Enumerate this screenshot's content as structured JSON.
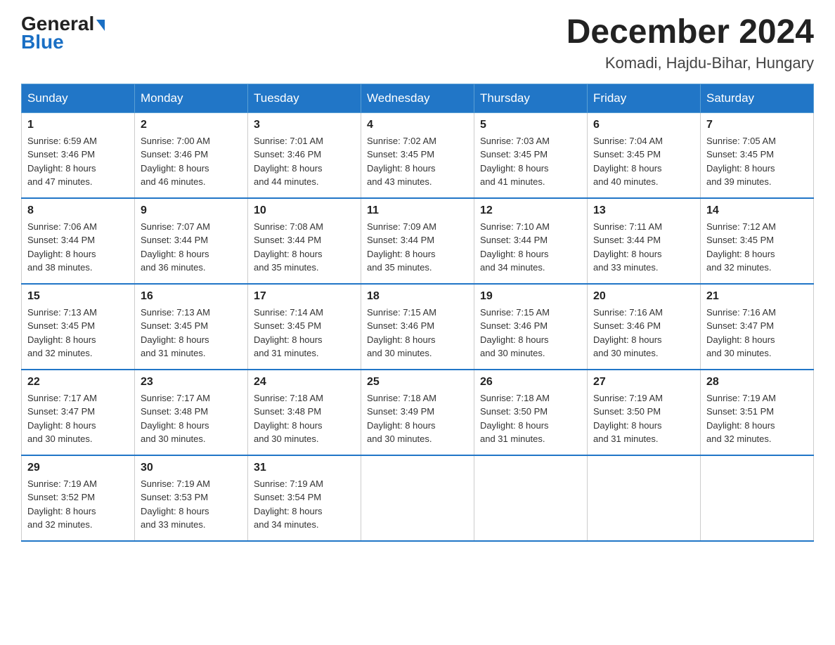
{
  "logo": {
    "line1": "General",
    "line2": "Blue"
  },
  "title": "December 2024",
  "location": "Komadi, Hajdu-Bihar, Hungary",
  "weekdays": [
    "Sunday",
    "Monday",
    "Tuesday",
    "Wednesday",
    "Thursday",
    "Friday",
    "Saturday"
  ],
  "weeks": [
    [
      {
        "day": "1",
        "sunrise": "6:59 AM",
        "sunset": "3:46 PM",
        "daylight": "8 hours and 47 minutes."
      },
      {
        "day": "2",
        "sunrise": "7:00 AM",
        "sunset": "3:46 PM",
        "daylight": "8 hours and 46 minutes."
      },
      {
        "day": "3",
        "sunrise": "7:01 AM",
        "sunset": "3:46 PM",
        "daylight": "8 hours and 44 minutes."
      },
      {
        "day": "4",
        "sunrise": "7:02 AM",
        "sunset": "3:45 PM",
        "daylight": "8 hours and 43 minutes."
      },
      {
        "day": "5",
        "sunrise": "7:03 AM",
        "sunset": "3:45 PM",
        "daylight": "8 hours and 41 minutes."
      },
      {
        "day": "6",
        "sunrise": "7:04 AM",
        "sunset": "3:45 PM",
        "daylight": "8 hours and 40 minutes."
      },
      {
        "day": "7",
        "sunrise": "7:05 AM",
        "sunset": "3:45 PM",
        "daylight": "8 hours and 39 minutes."
      }
    ],
    [
      {
        "day": "8",
        "sunrise": "7:06 AM",
        "sunset": "3:44 PM",
        "daylight": "8 hours and 38 minutes."
      },
      {
        "day": "9",
        "sunrise": "7:07 AM",
        "sunset": "3:44 PM",
        "daylight": "8 hours and 36 minutes."
      },
      {
        "day": "10",
        "sunrise": "7:08 AM",
        "sunset": "3:44 PM",
        "daylight": "8 hours and 35 minutes."
      },
      {
        "day": "11",
        "sunrise": "7:09 AM",
        "sunset": "3:44 PM",
        "daylight": "8 hours and 35 minutes."
      },
      {
        "day": "12",
        "sunrise": "7:10 AM",
        "sunset": "3:44 PM",
        "daylight": "8 hours and 34 minutes."
      },
      {
        "day": "13",
        "sunrise": "7:11 AM",
        "sunset": "3:44 PM",
        "daylight": "8 hours and 33 minutes."
      },
      {
        "day": "14",
        "sunrise": "7:12 AM",
        "sunset": "3:45 PM",
        "daylight": "8 hours and 32 minutes."
      }
    ],
    [
      {
        "day": "15",
        "sunrise": "7:13 AM",
        "sunset": "3:45 PM",
        "daylight": "8 hours and 32 minutes."
      },
      {
        "day": "16",
        "sunrise": "7:13 AM",
        "sunset": "3:45 PM",
        "daylight": "8 hours and 31 minutes."
      },
      {
        "day": "17",
        "sunrise": "7:14 AM",
        "sunset": "3:45 PM",
        "daylight": "8 hours and 31 minutes."
      },
      {
        "day": "18",
        "sunrise": "7:15 AM",
        "sunset": "3:46 PM",
        "daylight": "8 hours and 30 minutes."
      },
      {
        "day": "19",
        "sunrise": "7:15 AM",
        "sunset": "3:46 PM",
        "daylight": "8 hours and 30 minutes."
      },
      {
        "day": "20",
        "sunrise": "7:16 AM",
        "sunset": "3:46 PM",
        "daylight": "8 hours and 30 minutes."
      },
      {
        "day": "21",
        "sunrise": "7:16 AM",
        "sunset": "3:47 PM",
        "daylight": "8 hours and 30 minutes."
      }
    ],
    [
      {
        "day": "22",
        "sunrise": "7:17 AM",
        "sunset": "3:47 PM",
        "daylight": "8 hours and 30 minutes."
      },
      {
        "day": "23",
        "sunrise": "7:17 AM",
        "sunset": "3:48 PM",
        "daylight": "8 hours and 30 minutes."
      },
      {
        "day": "24",
        "sunrise": "7:18 AM",
        "sunset": "3:48 PM",
        "daylight": "8 hours and 30 minutes."
      },
      {
        "day": "25",
        "sunrise": "7:18 AM",
        "sunset": "3:49 PM",
        "daylight": "8 hours and 30 minutes."
      },
      {
        "day": "26",
        "sunrise": "7:18 AM",
        "sunset": "3:50 PM",
        "daylight": "8 hours and 31 minutes."
      },
      {
        "day": "27",
        "sunrise": "7:19 AM",
        "sunset": "3:50 PM",
        "daylight": "8 hours and 31 minutes."
      },
      {
        "day": "28",
        "sunrise": "7:19 AM",
        "sunset": "3:51 PM",
        "daylight": "8 hours and 32 minutes."
      }
    ],
    [
      {
        "day": "29",
        "sunrise": "7:19 AM",
        "sunset": "3:52 PM",
        "daylight": "8 hours and 32 minutes."
      },
      {
        "day": "30",
        "sunrise": "7:19 AM",
        "sunset": "3:53 PM",
        "daylight": "8 hours and 33 minutes."
      },
      {
        "day": "31",
        "sunrise": "7:19 AM",
        "sunset": "3:54 PM",
        "daylight": "8 hours and 34 minutes."
      },
      null,
      null,
      null,
      null
    ]
  ],
  "labels": {
    "sunrise": "Sunrise:",
    "sunset": "Sunset:",
    "daylight": "Daylight:"
  }
}
